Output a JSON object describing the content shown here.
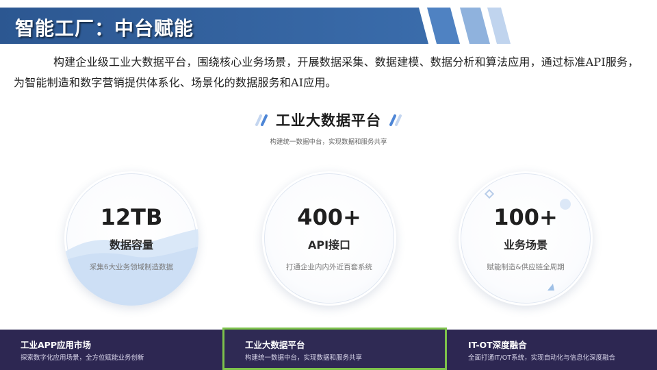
{
  "header": {
    "title": "智能工厂：中台赋能"
  },
  "intro": {
    "text": "构建企业级工业大数据平台，围绕核心业务场景，开展数据采集、数据建模、数据分析和算法应用，通过标准API服务，为智能制造和数字营销提供体系化、场景化的数据服务和AI应用。"
  },
  "platform": {
    "title": "工业大数据平台",
    "subtitle": "构建统一数据中台，实现数据和服务共享"
  },
  "stats": [
    {
      "value": "12TB",
      "label": "数据容量",
      "desc": "采集6大业务领域制造数据"
    },
    {
      "value": "400+",
      "label": "API接口",
      "desc": "打通企业内内外近百套系统"
    },
    {
      "value": "100+",
      "label": "业务场景",
      "desc": "赋能制造&供应链全周期"
    }
  ],
  "tabs": [
    {
      "title": "工业APP应用市场",
      "desc": "探索数字化应用场景，全方位赋能业务创新",
      "active": false
    },
    {
      "title": "工业大数据平台",
      "desc": "构建统一数据中台，实现数据和服务共享",
      "active": true
    },
    {
      "title": "IT-OT深度融合",
      "desc": "全面打通IT/OT系统，实现自动化与信息化深度融合",
      "active": false
    }
  ],
  "colors": {
    "title_bar": "#2f5e9a",
    "bottom_bar": "#2d2752",
    "active_border": "#7dc24b",
    "accent_light": "#9cc0ea"
  }
}
